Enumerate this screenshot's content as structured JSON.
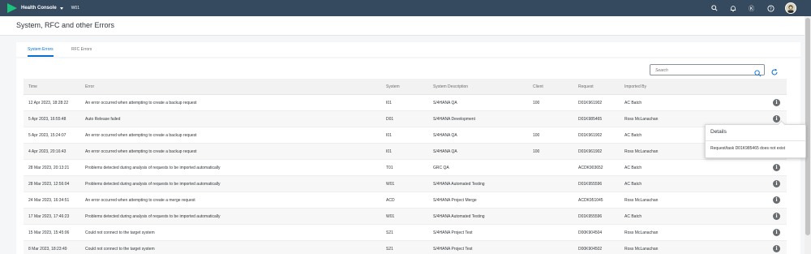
{
  "shell": {
    "app_title": "Health Console",
    "system": "W01",
    "icons": [
      "search-icon",
      "bell-icon",
      "settings-icon",
      "help-icon",
      "avatar-icon"
    ]
  },
  "page": {
    "title": "System, RFC and other Errors"
  },
  "tabs": [
    {
      "label": "System Errors",
      "active": true
    },
    {
      "label": "RFC Errors",
      "active": false
    }
  ],
  "search": {
    "placeholder": "Search",
    "value": ""
  },
  "table": {
    "columns": [
      "Time",
      "Error",
      "System",
      "System Description",
      "Client",
      "Request",
      "Imported By"
    ],
    "rows": [
      [
        "12 Apr 2023, 18:28:22",
        "An error occurred when attempting to create a backup request",
        "I01",
        "S/4HANA QA",
        "100",
        "D01K961902",
        "AC Batch"
      ],
      [
        "5 Apr 2023, 16:55:48",
        "Auto Release failed",
        "D01",
        "S/4HANA Development",
        "",
        "D01K985465",
        "Ross McLanachan"
      ],
      [
        "5 Apr 2023, 15:24:07",
        "An error occurred when attempting to create a backup request",
        "I01",
        "S/4HANA QA",
        "100",
        "D01K961902",
        "AC Batch"
      ],
      [
        "4 Apr 2023, 20:16:43",
        "An error occurred when attempting to create a backup request",
        "I01",
        "S/4HANA QA",
        "100",
        "D01K961902",
        "Ross McLanachan"
      ],
      [
        "28 Mar 2023, 20:13:21",
        "Problems detected during analysis of requests to be imported automatically",
        "T01",
        "GRC QA",
        "",
        "ACDK903652",
        "AC Batch"
      ],
      [
        "28 Mar 2023, 12:56:04",
        "Problems detected during analysis of requests to be imported automatically",
        "W01",
        "S/4HANA Automated Testing",
        "",
        "D01K955596",
        "AC Batch"
      ],
      [
        "24 Mar 2023, 16:34:51",
        "An error occurred when attempting to create a merge request",
        "ACD",
        "S/4HANA Project Merge",
        "",
        "ACDK951045",
        "Ross McLanachan"
      ],
      [
        "17 Mar 2023, 17:46:23",
        "Problems detected during analysis of requests to be imported automatically",
        "W01",
        "S/4HANA Automated Testing",
        "",
        "D01K955596",
        "AC Batch"
      ],
      [
        "15 Mar 2023, 15:45:06",
        "Could not connect to the target system",
        "S21",
        "S/4HANA Project Test",
        "",
        "D00K904504",
        "Ross McLanachan"
      ],
      [
        "8 Mar 2023, 18:23:49",
        "Could not connect to the target system",
        "S21",
        "S/4HANA Project Test",
        "",
        "D00K904502",
        "Ross McLanachan"
      ]
    ]
  },
  "popover": {
    "title": "Details",
    "message": "Request/task D01K985465 does not exist"
  },
  "colors": {
    "shell": "#354a5f",
    "accent": "#0a6ed1",
    "logo": "#1bc47d"
  }
}
